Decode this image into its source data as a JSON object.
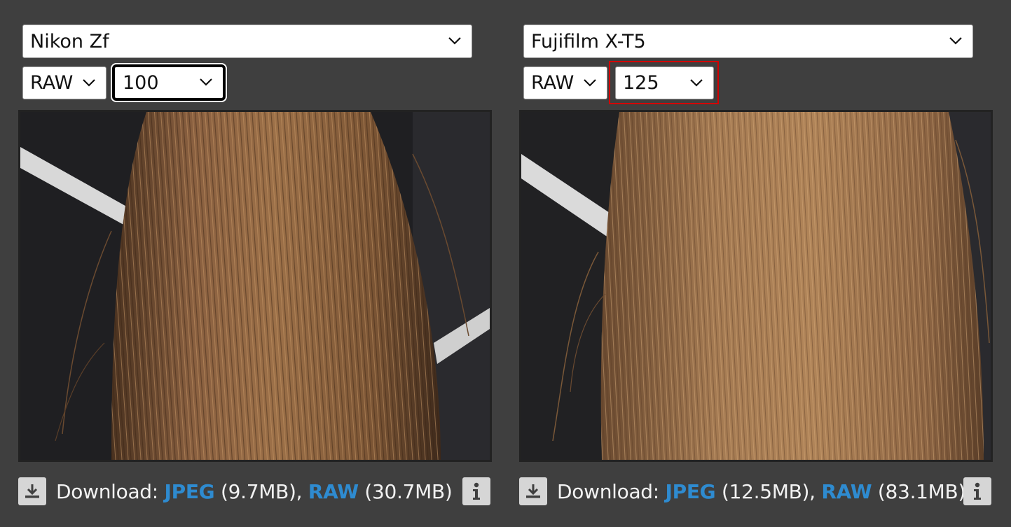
{
  "panels": [
    {
      "camera": "Nikon Zf",
      "format": "RAW",
      "iso": "100",
      "download": {
        "label": "Download: ",
        "jpeg_label": "JPEG",
        "jpeg_size": " (9.7MB), ",
        "raw_label": "RAW",
        "raw_size": " (30.7MB)"
      }
    },
    {
      "camera": "Fujifilm X-T5",
      "format": "RAW",
      "iso": "125",
      "download": {
        "label": "Download: ",
        "jpeg_label": "JPEG",
        "jpeg_size": " (12.5MB), ",
        "raw_label": "RAW",
        "raw_size": " (83.1MB)"
      }
    }
  ],
  "icons": {
    "download": "download-icon",
    "info": "info-icon",
    "chevron": "chevron-down-icon"
  },
  "colors": {
    "background": "#3f3f3f",
    "link": "#2e8bd0",
    "focus_ring": "#000000",
    "highlight": "#d40000"
  }
}
